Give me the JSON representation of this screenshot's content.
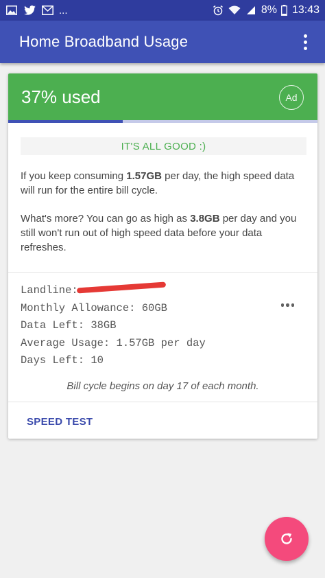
{
  "status_bar": {
    "left_icons": [
      "image-icon",
      "twitter-icon",
      "mail-icon"
    ],
    "ellipsis": "...",
    "right_icons": [
      "alarm-icon",
      "wifi-icon",
      "signal-icon",
      "battery-icon"
    ],
    "battery": "8%",
    "time": "13:43"
  },
  "app_bar": {
    "title": "Home Broadband Usage",
    "menu_icon": "more-vert-icon"
  },
  "card": {
    "used_label": "37% used",
    "used_fraction": 0.37,
    "ad_label": "Ad",
    "status_message": "IT'S ALL GOOD :)",
    "paragraph1": {
      "before": "If you keep consuming ",
      "value": "1.57GB",
      "after": " per day, the high speed data will run for the entire bill cycle."
    },
    "paragraph2": {
      "before": "What's more? You can go as high as ",
      "value": "3.8GB",
      "after": " per day and you still won't run out of high speed data before your data refreshes."
    },
    "details": {
      "landline_label": "Landline:",
      "monthly_allowance": "Monthly Allowance: 60GB",
      "data_left": "Data Left: 38GB",
      "average_usage": "Average Usage: 1.57GB per day",
      "days_left": "Days Left: 10"
    },
    "cycle_note": "Bill cycle begins on day 17 of each month.",
    "speed_test_label": "SPEED TEST"
  },
  "fab": {
    "icon": "refresh-icon"
  },
  "colors": {
    "status_bar": "#2f3c9e",
    "app_bar": "#3f51b5",
    "header_green": "#4caf50",
    "progress_fill": "#3f51b5",
    "progress_track": "#c5cae9",
    "fab": "#f44a7c",
    "redaction": "#e53935"
  }
}
